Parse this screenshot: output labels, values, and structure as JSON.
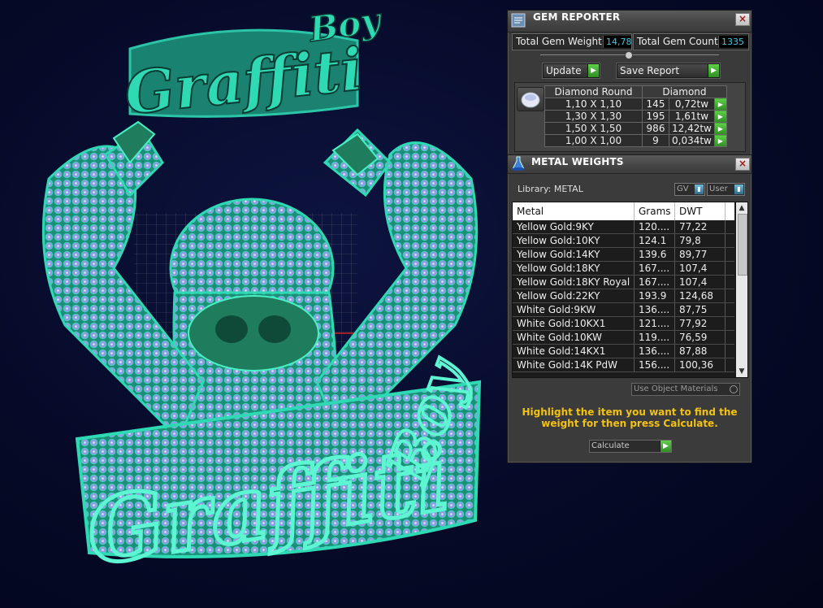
{
  "gem_reporter": {
    "title": "GEM REPORTER",
    "close": "×",
    "total_weight_label": "Total Gem Weight",
    "total_weight_value": "14,78",
    "total_count_label": "Total Gem Count",
    "total_count_value": "1335",
    "update_label": "Update",
    "save_report_label": "Save Report",
    "table": {
      "headers": [
        "Diamond Round",
        "Diamond"
      ],
      "rows": [
        {
          "size": "1,10 X 1,10",
          "count": "145",
          "weight": "0,72tw"
        },
        {
          "size": "1,30 X 1,30",
          "count": "195",
          "weight": "1,61tw"
        },
        {
          "size": "1,50 X 1,50",
          "count": "986",
          "weight": "12,42tw"
        },
        {
          "size": "1,00 X 1,00",
          "count": "9",
          "weight": "0,034tw"
        }
      ]
    }
  },
  "metal_weights": {
    "title": "METAL WEIGHTS",
    "close": "×",
    "library_label": "Library: METAL",
    "gv_toggle": "GV",
    "user_toggle": "User",
    "columns": [
      "Metal",
      "Grams",
      "DWT"
    ],
    "rows": [
      {
        "metal": "Yellow Gold:9KY",
        "grams": "120....",
        "dwt": "77,22"
      },
      {
        "metal": "Yellow Gold:10KY",
        "grams": "124.1",
        "dwt": "79,8"
      },
      {
        "metal": "Yellow Gold:14KY",
        "grams": "139.6",
        "dwt": "89,77"
      },
      {
        "metal": "Yellow Gold:18KY",
        "grams": "167....",
        "dwt": "107,4"
      },
      {
        "metal": "Yellow Gold:18KY Royal",
        "grams": "167....",
        "dwt": "107,4"
      },
      {
        "metal": "Yellow Gold:22KY",
        "grams": "193.9",
        "dwt": "124,68"
      },
      {
        "metal": "White Gold:9KW",
        "grams": "136....",
        "dwt": "87,75"
      },
      {
        "metal": "White Gold:10KX1",
        "grams": "121....",
        "dwt": "77,92"
      },
      {
        "metal": "White Gold:10KW",
        "grams": "119....",
        "dwt": "76,59"
      },
      {
        "metal": "White Gold:14KX1",
        "grams": "136....",
        "dwt": "87,88"
      },
      {
        "metal": "White Gold:14K PdW",
        "grams": "156....",
        "dwt": "100,36"
      }
    ],
    "use_object_materials_label": "Use Object Materials",
    "hint": "Highlight the item you want to find the weight for then press Calculate.",
    "calculate_label": "Calculate"
  },
  "artwork": {
    "top_word_1": "Boy",
    "top_word_2": "Graffiti",
    "bottom_word_1": "Boy",
    "bottom_word_2": "Graffiti",
    "colors": {
      "metal": "#2fd9b4",
      "stones": "#8f9fe0",
      "background": "#060a28"
    }
  }
}
